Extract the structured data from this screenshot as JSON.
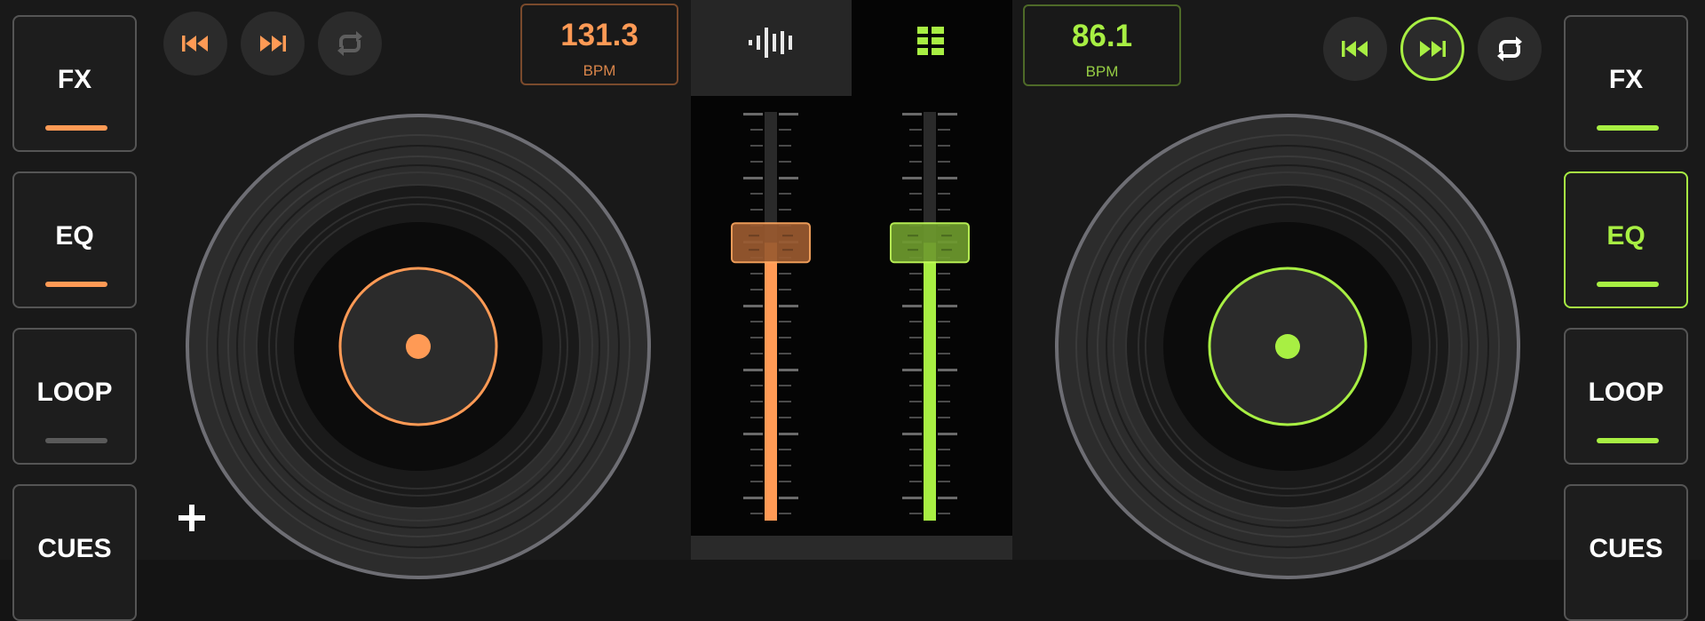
{
  "colors": {
    "deck_a_accent": "#ff9a55",
    "deck_b_accent": "#a8ef43",
    "off_indicator": "#5a5a5a"
  },
  "deck_a": {
    "bpm_value": "131.3",
    "bpm_unit": "BPM",
    "side_buttons": [
      {
        "label": "FX",
        "indicator_on": true
      },
      {
        "label": "EQ",
        "indicator_on": true
      },
      {
        "label": "LOOP",
        "indicator_on": false
      },
      {
        "label": "CUES"
      }
    ],
    "transport_icons": [
      "skip-back-icon",
      "skip-forward-icon",
      "loop-icon"
    ],
    "extra_icon": "plus-icon"
  },
  "deck_b": {
    "bpm_value": "86.1",
    "bpm_unit": "BPM",
    "side_buttons": [
      {
        "label": "FX",
        "indicator_on": true
      },
      {
        "label": "EQ",
        "indicator_on": true,
        "selected": true
      },
      {
        "label": "LOOP",
        "indicator_on": true
      },
      {
        "label": "CUES"
      }
    ],
    "transport_icons": [
      "skip-back-icon",
      "skip-forward-icon",
      "loop-icon"
    ],
    "skip_forward_active": true
  },
  "mixer": {
    "tabs": [
      {
        "icon": "waveform-icon",
        "selected": true
      },
      {
        "icon": "grid-icon",
        "selected": false
      }
    ],
    "channel_a_level": 0.68,
    "channel_b_level": 0.68
  }
}
